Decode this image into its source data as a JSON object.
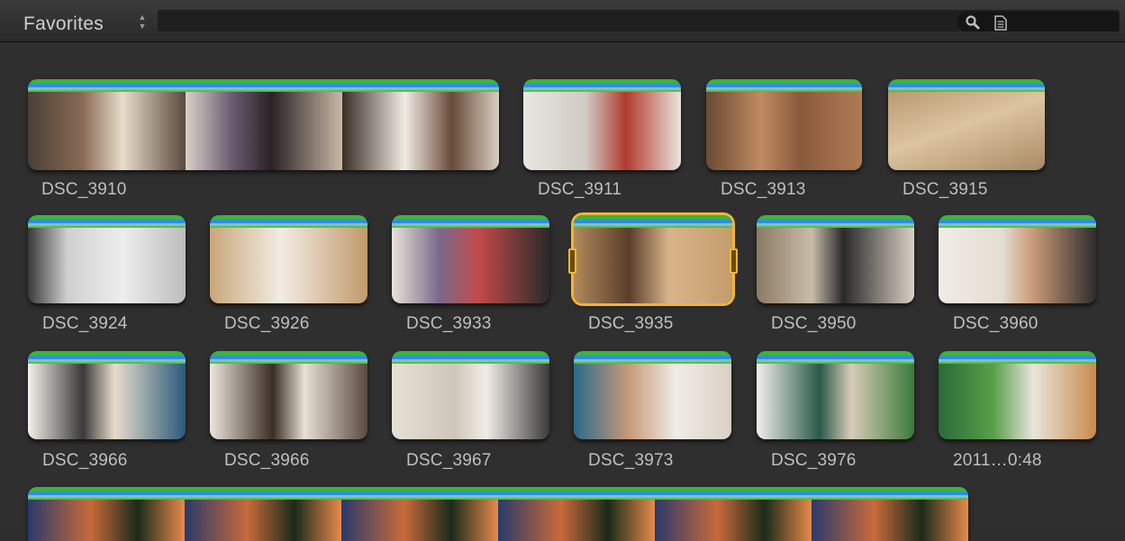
{
  "toolbar": {
    "favorites_label": "Favorites",
    "sort_icon": "up-down-arrows-icon",
    "search_icon": "search-icon",
    "doc_icon": "document-icon"
  },
  "clips": [
    {
      "label": "DSC_3910"
    },
    {
      "label": "DSC_3911"
    },
    {
      "label": "DSC_3913"
    },
    {
      "label": "DSC_3915"
    },
    {
      "label": "DSC_3924"
    },
    {
      "label": "DSC_3926"
    },
    {
      "label": "DSC_3933"
    },
    {
      "label": "DSC_3935"
    },
    {
      "label": "DSC_3950"
    },
    {
      "label": "DSC_3960"
    },
    {
      "label": "DSC_3966"
    },
    {
      "label": "DSC_3966"
    },
    {
      "label": "DSC_3967"
    },
    {
      "label": "DSC_3973"
    },
    {
      "label": "DSC_3976"
    },
    {
      "label": "2011…0:48"
    }
  ],
  "colors": {
    "selection": "#f2b631",
    "favorite_bar": "#39b53f",
    "keyword_bar": "#2f8fd9"
  }
}
